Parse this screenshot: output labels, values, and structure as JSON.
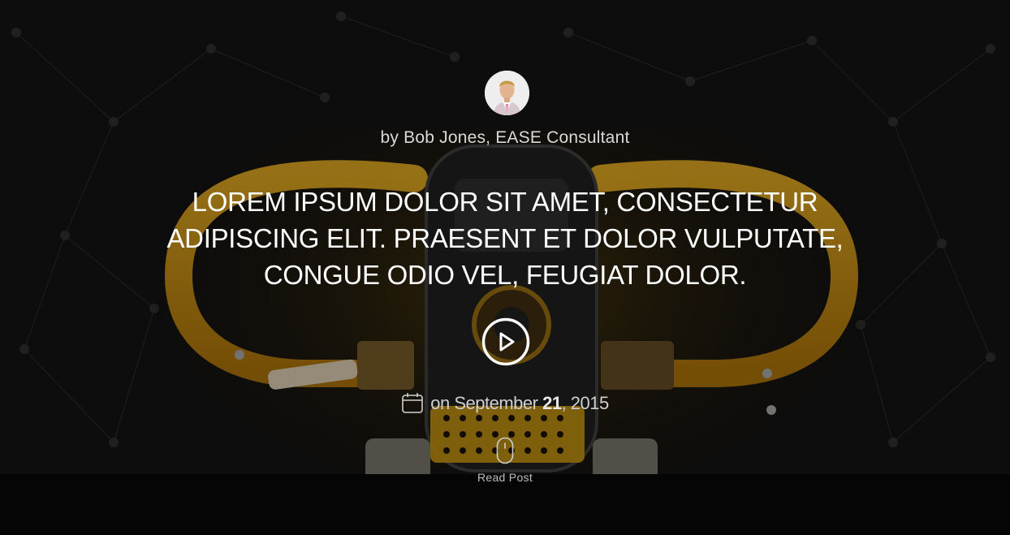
{
  "author": {
    "byline": "by Bob Jones, EASE Consultant"
  },
  "post": {
    "title": "LOREM IPSUM DOLOR SIT AMET, CONSECTETUR ADIPISCING ELIT. PRAESENT ET DOLOR VULPUTATE, CONGUE ODIO VEL, FEUGIAT DOLOR.",
    "date_prefix": "on September",
    "date_day": "21",
    "date_year": ", 2015"
  },
  "actions": {
    "read_post_label": "Read Post"
  },
  "icons": {
    "play": "play-circle-icon",
    "calendar": "calendar-icon",
    "scroll": "mouse-scroll-icon"
  },
  "colors": {
    "accent_yellow": "#e8a80c",
    "background": "#121212"
  }
}
